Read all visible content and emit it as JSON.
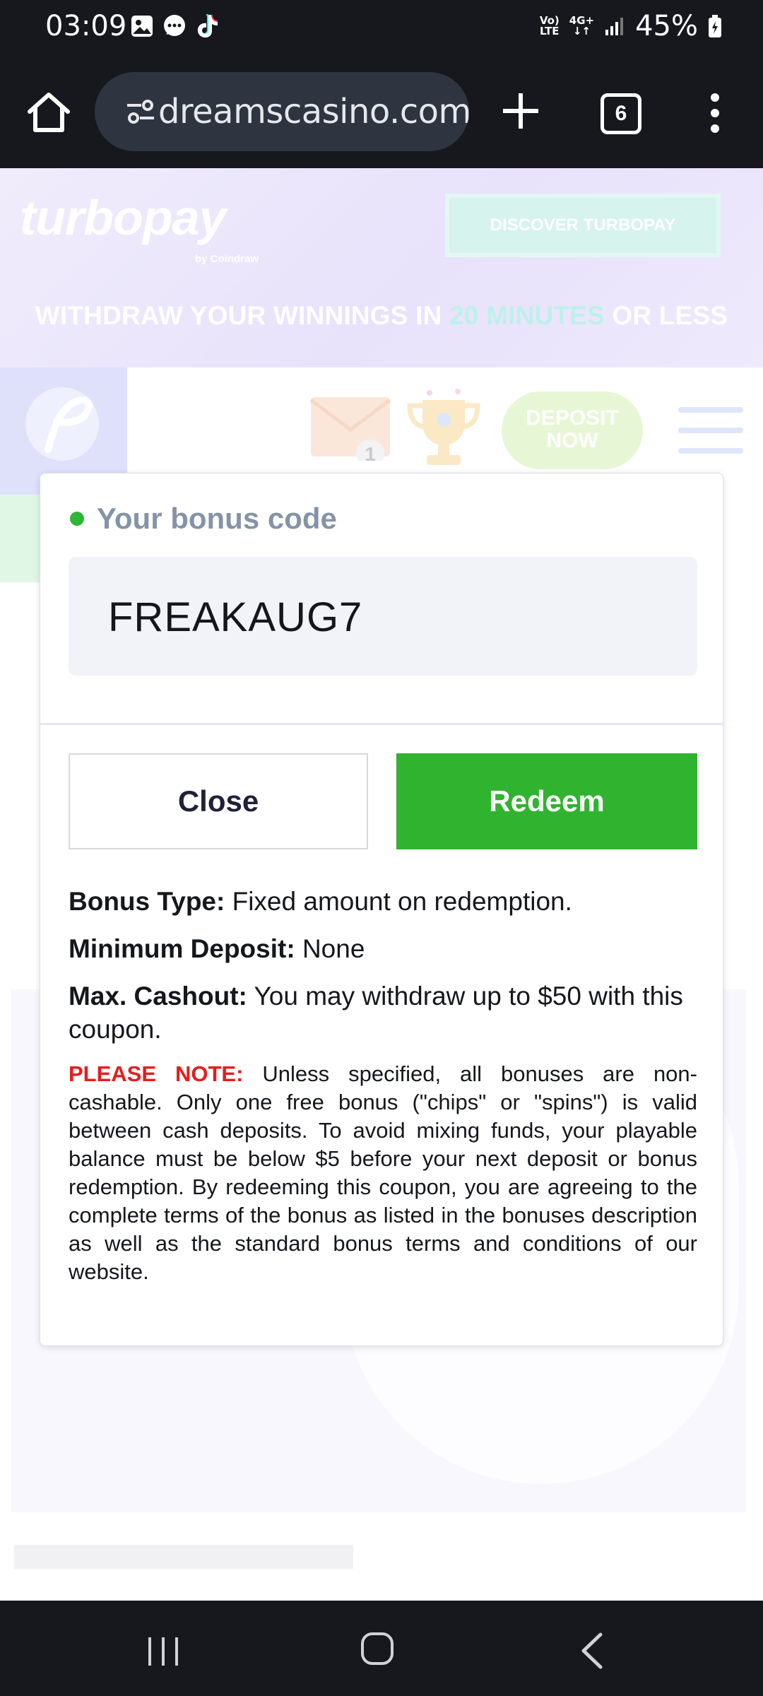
{
  "status_bar": {
    "time": "03:09",
    "network_top": "Vo)",
    "network_bottom": "LTE",
    "signal_type": "4G+",
    "battery": "45%"
  },
  "browser": {
    "url": "dreamscasino.com",
    "tabs_count": "6"
  },
  "banner": {
    "logo": "turbopay",
    "logo_sub": "by Coindraw",
    "discover_button": "DISCOVER TURBOPAY",
    "headline_part1": "WITHDRAW YOUR WINNINGS IN ",
    "headline_highlight": "20 MINUTES",
    "headline_part2": " OR LESS"
  },
  "site_header": {
    "mail_count": "1",
    "deposit_line1": "DEPOSIT",
    "deposit_line2": "NOW"
  },
  "modal": {
    "code_label": "Your bonus code",
    "code_value": "FREAKAUG7",
    "close_label": "Close",
    "redeem_label": "Redeem",
    "bonus_type_label": "Bonus Type:",
    "bonus_type_value": " Fixed amount on redemption.",
    "min_deposit_label": "Minimum Deposit:",
    "min_deposit_value": " None",
    "max_cashout_label": "Max. Cashout:",
    "max_cashout_value": " You may withdraw up to $50 with this coupon.",
    "note_label": "PLEASE NOTE:",
    "note_text": " Unless specified, all bonuses are non-cashable. Only one free bonus (\"chips\" or \"spins\") is valid between cash deposits. To avoid mixing funds, your playable balance must be below $5 before your next deposit or bonus redemption. By redeeming this coupon, you are agreeing to the complete terms of the bonus as listed in the bonuses description as well as the standard bonus terms and conditions of our website."
  },
  "colors": {
    "accent_green": "#30b32f",
    "note_red": "#e81c1c",
    "label_gray": "#8593a8"
  },
  "icons": [
    "home-icon",
    "site-settings-icon",
    "new-tab-icon",
    "tab-switcher-icon",
    "more-menu-icon",
    "mail-icon",
    "trophy-icon",
    "hamburger-menu-icon",
    "nav-recents-icon",
    "nav-home-icon",
    "nav-back-icon"
  ]
}
